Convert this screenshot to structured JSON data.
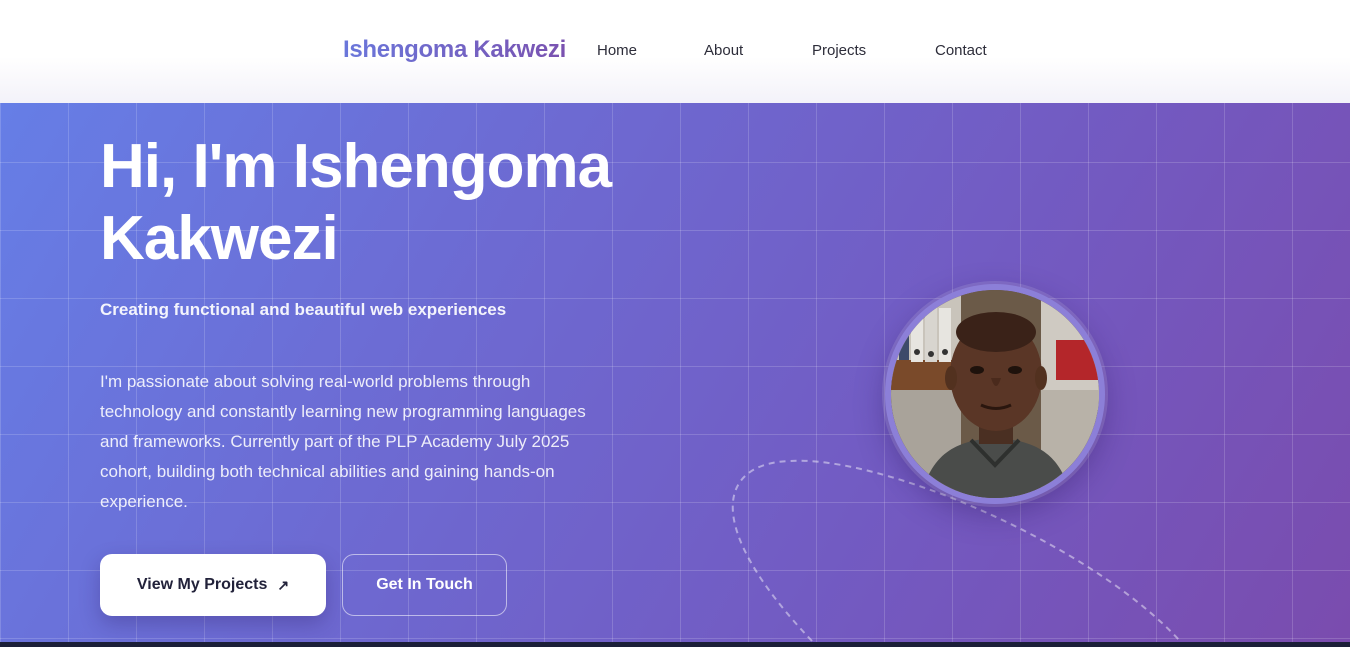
{
  "nav": {
    "brand": "Ishengoma Kakwezi",
    "links": [
      "Home",
      "About",
      "Projects",
      "Contact"
    ]
  },
  "hero": {
    "title": "Hi, I'm Ishengoma Kakwezi",
    "subtitle": "Creating functional and beautiful web experiences",
    "description": "I'm passionate about solving real-world problems through technology and constantly learning new programming languages and frameworks. Currently part of the PLP Academy July 2025 cohort, building both technical abilities and gaining hands-on experience.",
    "primary_button": "View My Projects",
    "primary_button_icon": "arrow-up-right-icon",
    "secondary_button": "Get In Touch",
    "avatar_icon": "profile-photo"
  },
  "colors": {
    "brand_gradient_start": "#6a77db",
    "brand_gradient_end": "#7a52b0",
    "hero_gradient_start": "#667ee6",
    "hero_gradient_end": "#7a4cae",
    "button_primary_bg": "#ffffff",
    "text_dark": "#22223a"
  }
}
